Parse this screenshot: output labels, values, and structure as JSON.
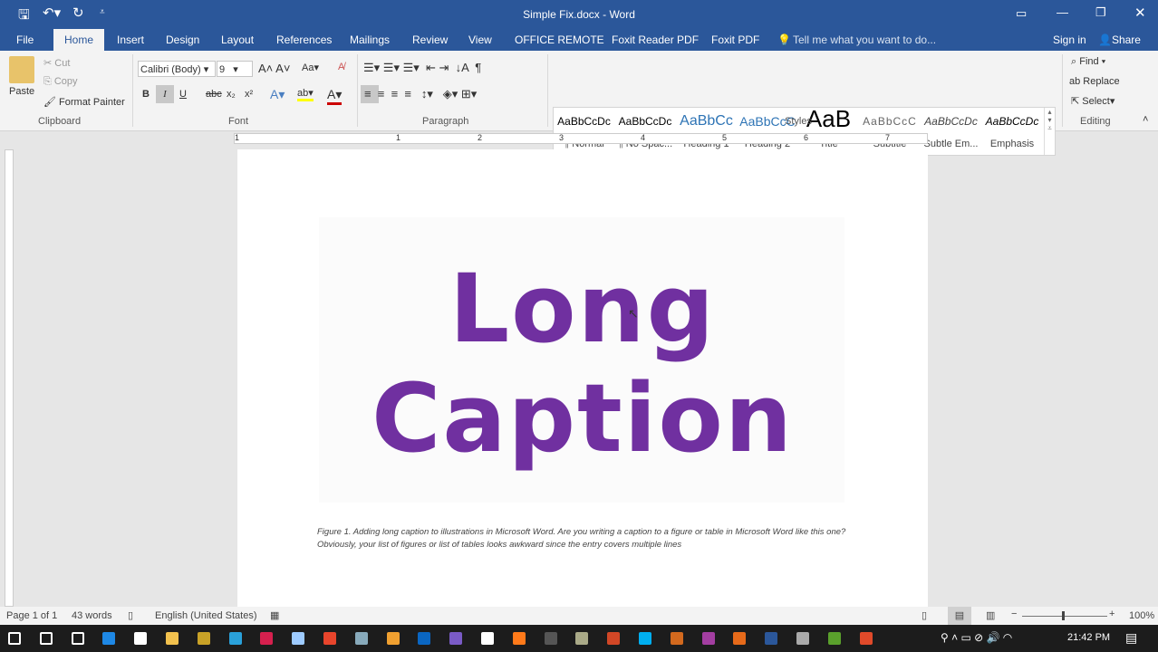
{
  "window": {
    "title": "Simple Fix.docx - Word"
  },
  "tabs": [
    "File",
    "Home",
    "Insert",
    "Design",
    "Layout",
    "References",
    "Mailings",
    "Review",
    "View",
    "OFFICE REMOTE",
    "Foxit Reader PDF",
    "Foxit PDF"
  ],
  "tell_me": "Tell me what you want to do...",
  "sign_in": "Sign in",
  "share": "Share",
  "clipboard": {
    "paste": "Paste",
    "cut": "Cut",
    "copy": "Copy",
    "format_painter": "Format Painter",
    "label": "Clipboard"
  },
  "font": {
    "name": "Calibri (Body)",
    "size": "9",
    "label": "Font",
    "bold": "B",
    "italic": "I",
    "underline": "U",
    "strike": "abc",
    "sub": "x₂",
    "sup": "x²",
    "case": "Aa"
  },
  "paragraph": {
    "label": "Paragraph"
  },
  "styles": {
    "label": "Styles",
    "items": [
      {
        "preview": "AaBbCcDc",
        "name": "¶ Normal"
      },
      {
        "preview": "AaBbCcDc",
        "name": "¶ No Spac..."
      },
      {
        "preview": "AaBbCc",
        "name": "Heading 1"
      },
      {
        "preview": "AaBbCcC",
        "name": "Heading 2"
      },
      {
        "preview": "AaB",
        "name": "Title"
      },
      {
        "preview": "AaBbCcC",
        "name": "Subtitle"
      },
      {
        "preview": "AaBbCcDc",
        "name": "Subtle Em..."
      },
      {
        "preview": "AaBbCcDc",
        "name": "Emphasis"
      }
    ]
  },
  "editing": {
    "find": "Find",
    "replace": "Replace",
    "select": "Select",
    "label": "Editing"
  },
  "ruler": [
    "1",
    "1",
    "2",
    "3",
    "4",
    "5",
    "6",
    "7"
  ],
  "document": {
    "line1": "Long",
    "line2": "Caption",
    "caption": "Figure 1. Adding long caption to illustrations in Microsoft Word. Are you writing a caption to a figure or table in Microsoft Word like this one? Obviously, your list of figures or list of tables looks awkward since the entry covers multiple lines",
    "text_color": "#7030a0"
  },
  "status": {
    "page": "Page 1 of 1",
    "words": "43 words",
    "language": "English (United States)",
    "zoom": "100%"
  },
  "taskbar": {
    "time": "21:42 PM",
    "icons": [
      "start",
      "search",
      "task-view",
      "edge",
      "store",
      "file-explorer",
      "app",
      "telegram",
      "app-m",
      "app",
      "chrome",
      "app",
      "app",
      "linkedin",
      "app",
      "mail",
      "firefox",
      "app",
      "app",
      "powerpoint",
      "skype",
      "app",
      "app",
      "app",
      "word",
      "app",
      "app",
      "app"
    ]
  }
}
